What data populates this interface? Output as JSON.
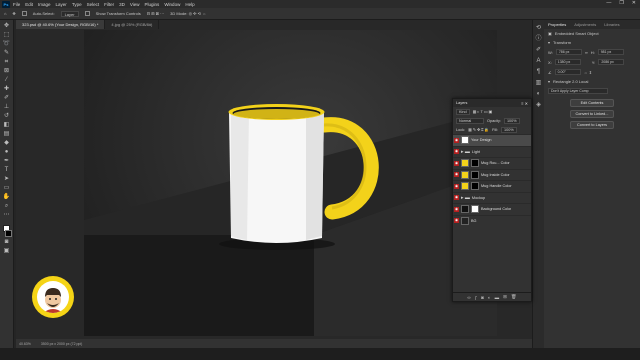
{
  "menubar": {
    "items": [
      "File",
      "Edit",
      "Image",
      "Layer",
      "Type",
      "Select",
      "Filter",
      "3D",
      "View",
      "Plugins",
      "Window",
      "Help"
    ],
    "window_controls": [
      "—",
      "❐",
      "✕"
    ]
  },
  "options_bar": {
    "auto_select_label": "Auto-Select:",
    "auto_select_value": "Layer",
    "show_transform_label": "Show Transform Controls"
  },
  "tabs": [
    {
      "label": "323.psd @ 40.6% (Your Design, RGB/16) *",
      "active": true
    },
    {
      "label": "4.jpg @ 25% (RGB/8#)",
      "active": false
    }
  ],
  "statusbar": {
    "zoom": "40.63%",
    "doc_info": "3500 px x 2000 px (72 ppi)"
  },
  "properties": {
    "tabs": [
      "Properties",
      "Adjustments",
      "Libraries"
    ],
    "object_type": "Embedded Smart Object",
    "transform_label": "Transform",
    "w_label": "W:",
    "w_value": "786 px",
    "h_label": "H:",
    "h_value": "981 px",
    "x_label": "X:",
    "x_value": "1380 px",
    "y_label": "Y:",
    "y_value": "2086 px",
    "angle_value": "0.00°",
    "rectangle_label": "Rectangle 2.0 Local",
    "layer_comp": "Don't Apply Layer Comp",
    "buttons": [
      "Edit Contents",
      "Convert to Linked...",
      "Convert to Layers"
    ]
  },
  "layers_panel": {
    "title": "Layers",
    "kind_label": "Kind",
    "blend_mode": "Normal",
    "opacity_label": "Opacity:",
    "opacity_value": "100%",
    "lock_label": "Lock:",
    "fill_label": "Fill:",
    "fill_value": "100%",
    "layers": [
      {
        "name": "Your Design",
        "visible": true,
        "selected": true,
        "thumb": "#ffffff"
      },
      {
        "name": "Light",
        "visible": true,
        "selected": false,
        "thumb": "#777777"
      },
      {
        "name": "Mug Rou... Color",
        "visible": true,
        "selected": false,
        "thumb": "#f3d21a"
      },
      {
        "name": "Mug Inside Color",
        "visible": true,
        "selected": false,
        "thumb": "#f3d21a"
      },
      {
        "name": "Mug Handle Color",
        "visible": true,
        "selected": false,
        "thumb": "#f3d21a"
      },
      {
        "name": "Mockup",
        "visible": true,
        "selected": false,
        "thumb": "#555555"
      },
      {
        "name": "Background Color",
        "visible": true,
        "selected": false,
        "thumb": "#111111"
      },
      {
        "name": "BG",
        "visible": true,
        "selected": false,
        "thumb": "#222222"
      }
    ],
    "footer_icons": [
      "link-icon",
      "fx-icon",
      "mask-icon",
      "adjustment-icon",
      "folder-icon",
      "new-layer-icon",
      "trash-icon"
    ]
  },
  "colors": {
    "mug_accent": "#f3d21a",
    "mug_body": "#ffffff",
    "layer_eye": "#b31f1f"
  }
}
